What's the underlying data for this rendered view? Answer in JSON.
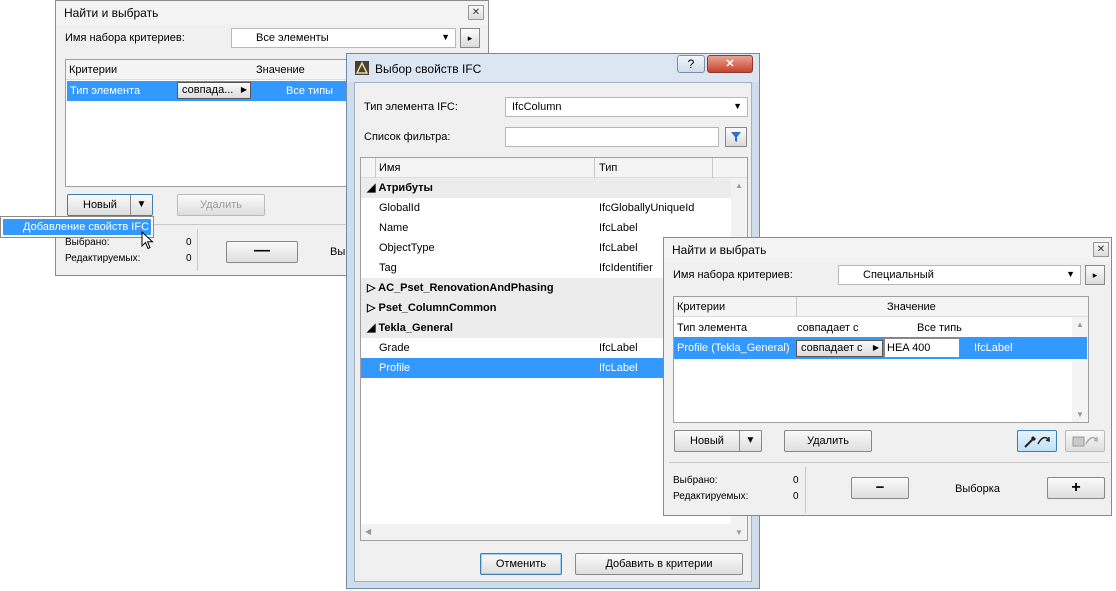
{
  "win1": {
    "title": "Найти и выбрать",
    "set_label": "Имя набора критериев:",
    "set_value": "Все элементы",
    "col_criteria": "Критерии",
    "col_value": "Значение",
    "row_criteria": "Тип элемента",
    "row_op": "совпада...",
    "row_value": "Все типы",
    "new_btn": "Новый",
    "delete_btn": "Удалить",
    "selected_label": "Выбрано:",
    "selected_count": "0",
    "editable_label": "Редактируемых:",
    "editable_count": "0",
    "trailing_text": "Вы",
    "menu_item": "Добавление свойств IFC"
  },
  "win2": {
    "title": "Выбор свойств IFC",
    "help": "?",
    "ifc_type_label": "Тип элемента IFC:",
    "ifc_type_value": "IfcColumn",
    "filter_label": "Список фильтра:",
    "filter_value": "",
    "col_name": "Имя",
    "col_type": "Тип",
    "groups": [
      {
        "label": "Атрибуты",
        "expanded": true,
        "rows": [
          {
            "name": "GlobalId",
            "type": "IfcGloballyUniqueId"
          },
          {
            "name": "Name",
            "type": "IfcLabel"
          },
          {
            "name": "ObjectType",
            "type": "IfcLabel"
          },
          {
            "name": "Tag",
            "type": "IfcIdentifier"
          }
        ]
      },
      {
        "label": "AC_Pset_RenovationAndPhasing",
        "expanded": false,
        "rows": []
      },
      {
        "label": "Pset_ColumnCommon",
        "expanded": false,
        "rows": []
      },
      {
        "label": "Tekla_General",
        "expanded": true,
        "rows": [
          {
            "name": "Grade",
            "type": "IfcLabel"
          },
          {
            "name": "Profile",
            "type": "IfcLabel"
          }
        ]
      }
    ],
    "cancel_btn": "Отменить",
    "add_btn": "Добавить в критерии"
  },
  "win3": {
    "title": "Найти и выбрать",
    "set_label": "Имя набора критериев:",
    "set_value": "Специальный",
    "col_criteria": "Критерии",
    "col_value": "Значение",
    "row1": {
      "criteria": "Тип элемента",
      "op": "совпадает с",
      "value": "Все типь"
    },
    "row2": {
      "criteria": "Profile (Tekla_General)",
      "op": "совпадает с",
      "value": "HEA 400",
      "type": "IfcLabel"
    },
    "new_btn": "Новый",
    "delete_btn": "Удалить",
    "selected_label": "Выбрано:",
    "selected_count": "0",
    "editable_label": "Редактируемых:",
    "editable_count": "0",
    "selection_label": "Выборка",
    "minus": "−",
    "plus": "+"
  },
  "colors": {
    "selection": "#3399ff",
    "window_bg": "#f0f0f0"
  }
}
